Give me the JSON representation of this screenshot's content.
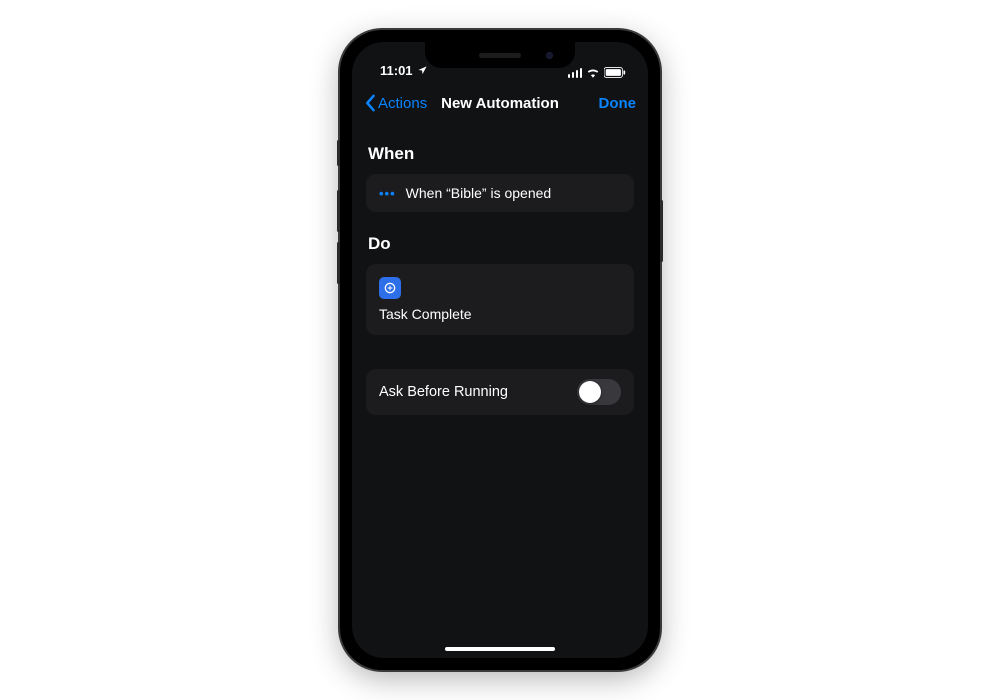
{
  "status_bar": {
    "time": "11:01"
  },
  "nav": {
    "back_label": "Actions",
    "title": "New Automation",
    "done_label": "Done"
  },
  "sections": {
    "when": {
      "heading": "When",
      "trigger_text": "When “Bible” is opened"
    },
    "do": {
      "heading": "Do",
      "action_label": "Task Complete"
    },
    "ask": {
      "label": "Ask Before Running",
      "enabled": false
    }
  },
  "colors": {
    "accent": "#0a84ff",
    "card_bg": "#1c1c1e",
    "screen_bg": "#111214"
  }
}
